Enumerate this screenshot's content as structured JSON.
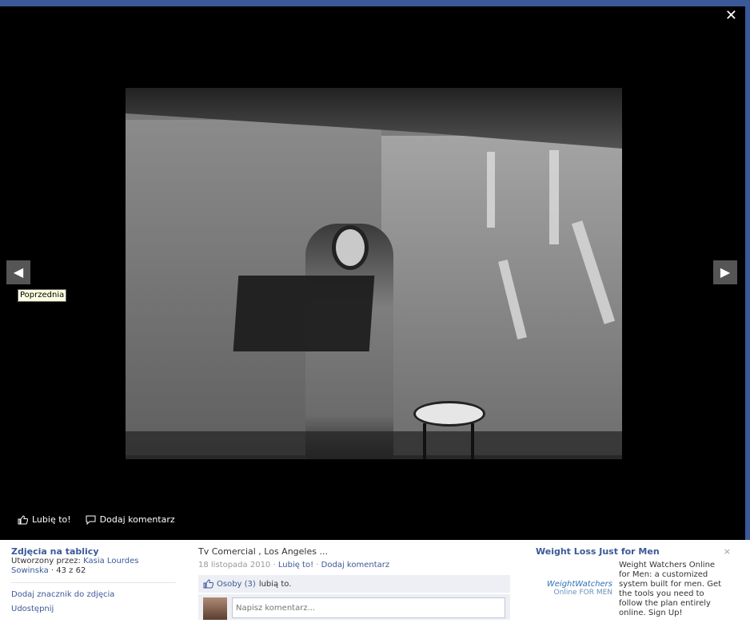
{
  "viewer": {
    "close_label": "✕",
    "prev_arrow": "◀",
    "next_arrow": "▶",
    "prev_tooltip": "Poprzednia"
  },
  "actions": {
    "like_label": "Lubię to!",
    "comment_label": "Dodaj komentarz"
  },
  "album": {
    "title": "Zdjęcia na tablicy",
    "created_by_prefix": "Utworzony przez:",
    "author": "Kasia Lourdes Sowinska",
    "separator": "·",
    "position": "43 z 62",
    "links": [
      "Dodaj znacznik do zdjęcia",
      "Udostępnij"
    ]
  },
  "photo_info": {
    "caption": "Tv Comercial , Los Angeles ...",
    "date": "18 listopada 2010",
    "dot": "·",
    "like_link": "Lubię to!",
    "comment_link": "Dodaj komentarz",
    "likes_link": "Osoby (3)",
    "likes_suffix": "lubią to.",
    "comment_placeholder": "Napisz komentarz..."
  },
  "ad": {
    "title": "Weight Loss Just for Men",
    "close": "×",
    "logo_line1": "WeightWatchers",
    "logo_line2": "Online FOR MEN",
    "body": "Weight Watchers Online for Men: a customized system built for men. Get the tools you need to follow the plan entirely online. Sign Up!"
  },
  "colors": {
    "brand_blue": "#3b5998",
    "likes_bg": "#edeff4",
    "tooltip_bg": "#ffffe1"
  }
}
